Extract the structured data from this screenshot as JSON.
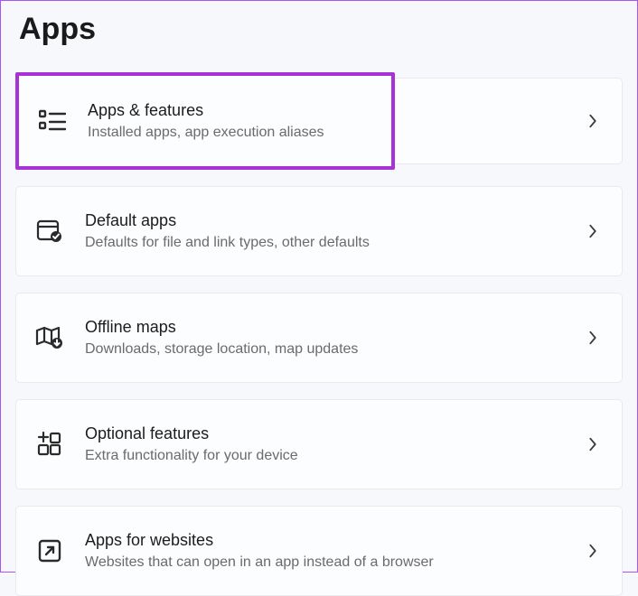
{
  "header": {
    "title": "Apps"
  },
  "items": [
    {
      "title": "Apps & features",
      "desc": "Installed apps, app execution aliases",
      "highlighted": true
    },
    {
      "title": "Default apps",
      "desc": "Defaults for file and link types, other defaults",
      "highlighted": false
    },
    {
      "title": "Offline maps",
      "desc": "Downloads, storage location, map updates",
      "highlighted": false
    },
    {
      "title": "Optional features",
      "desc": "Extra functionality for your device",
      "highlighted": false
    },
    {
      "title": "Apps for websites",
      "desc": "Websites that can open in an app instead of a browser",
      "highlighted": false
    }
  ],
  "colors": {
    "highlight": "#a832d8",
    "border": "#a855f7"
  }
}
